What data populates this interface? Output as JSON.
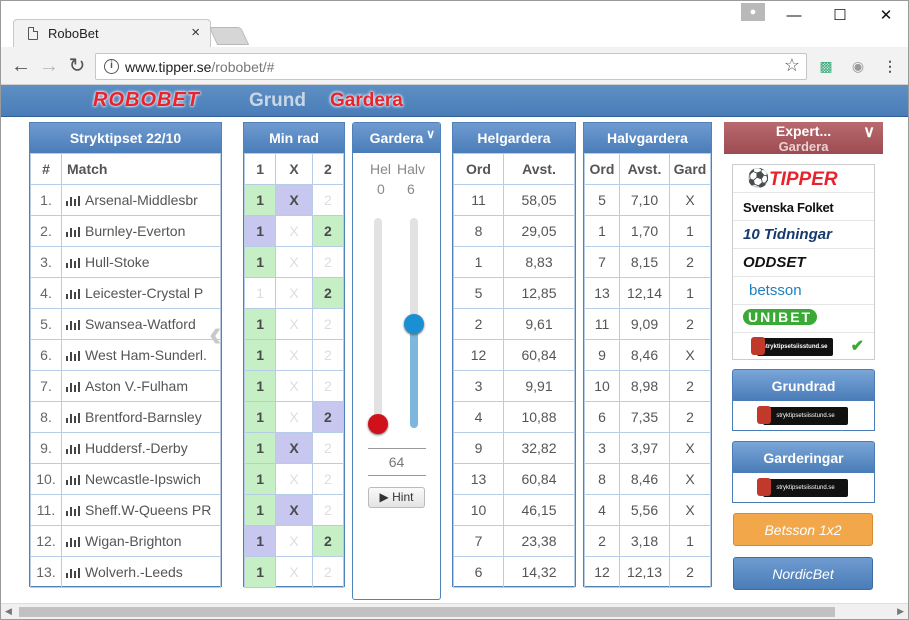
{
  "browser": {
    "tab_title": "RoboBet",
    "url_host": "www.tipper.se",
    "url_path": "/robobet/#"
  },
  "header": {
    "logo": "ROBOBET",
    "nav_grund": "Grund",
    "nav_gardera": "Gardera"
  },
  "stryktips": {
    "title": "Stryktipset 22/10",
    "col_num": "#",
    "col_match": "Match",
    "rows": [
      {
        "num": "1.",
        "match": "Arsenal-Middlesbr"
      },
      {
        "num": "2.",
        "match": "Burnley-Everton"
      },
      {
        "num": "3.",
        "match": "Hull-Stoke"
      },
      {
        "num": "4.",
        "match": "Leicester-Crystal P"
      },
      {
        "num": "5.",
        "match": "Swansea-Watford"
      },
      {
        "num": "6.",
        "match": "West Ham-Sunderl."
      },
      {
        "num": "7.",
        "match": "Aston V.-Fulham"
      },
      {
        "num": "8.",
        "match": "Brentford-Barnsley"
      },
      {
        "num": "9.",
        "match": "Huddersf.-Derby"
      },
      {
        "num": "10.",
        "match": "Newcastle-Ipswich"
      },
      {
        "num": "11.",
        "match": "Sheff.W-Queens PR"
      },
      {
        "num": "12.",
        "match": "Wigan-Brighton"
      },
      {
        "num": "13.",
        "match": "Wolverh.-Leeds"
      }
    ]
  },
  "minrad": {
    "title": "Min rad",
    "cols": [
      "1",
      "X",
      "2"
    ],
    "rows": [
      {
        "c1": "1",
        "cx": "X",
        "c2": "2",
        "s": [
          "g",
          "b",
          "d"
        ]
      },
      {
        "c1": "1",
        "cx": "X",
        "c2": "2",
        "s": [
          "b",
          "d",
          "g"
        ]
      },
      {
        "c1": "1",
        "cx": "X",
        "c2": "2",
        "s": [
          "g",
          "d",
          "d"
        ]
      },
      {
        "c1": "1",
        "cx": "X",
        "c2": "2",
        "s": [
          "d",
          "d",
          "g"
        ]
      },
      {
        "c1": "1",
        "cx": "X",
        "c2": "2",
        "s": [
          "g",
          "d",
          "d"
        ]
      },
      {
        "c1": "1",
        "cx": "X",
        "c2": "2",
        "s": [
          "g",
          "d",
          "d"
        ]
      },
      {
        "c1": "1",
        "cx": "X",
        "c2": "2",
        "s": [
          "g",
          "d",
          "d"
        ]
      },
      {
        "c1": "1",
        "cx": "X",
        "c2": "2",
        "s": [
          "g",
          "d",
          "b"
        ]
      },
      {
        "c1": "1",
        "cx": "X",
        "c2": "2",
        "s": [
          "g",
          "b",
          "d"
        ]
      },
      {
        "c1": "1",
        "cx": "X",
        "c2": "2",
        "s": [
          "g",
          "d",
          "d"
        ]
      },
      {
        "c1": "1",
        "cx": "X",
        "c2": "2",
        "s": [
          "g",
          "b",
          "d"
        ]
      },
      {
        "c1": "1",
        "cx": "X",
        "c2": "2",
        "s": [
          "b",
          "d",
          "g"
        ]
      },
      {
        "c1": "1",
        "cx": "X",
        "c2": "2",
        "s": [
          "g",
          "d",
          "d"
        ]
      }
    ]
  },
  "gardera": {
    "title": "Gardera",
    "hel_label": "Hel",
    "halv_label": "Halv",
    "hel_value": "0",
    "halv_value": "6",
    "hel_level": 0,
    "halv_level": 0.5,
    "total": "64",
    "hint_label": "Hint"
  },
  "helgardera": {
    "title": "Helgardera",
    "col_ord": "Ord",
    "col_avst": "Avst.",
    "rows": [
      [
        "11",
        "58,05"
      ],
      [
        "8",
        "29,05"
      ],
      [
        "1",
        "8,83"
      ],
      [
        "5",
        "12,85"
      ],
      [
        "2",
        "9,61"
      ],
      [
        "12",
        "60,84"
      ],
      [
        "3",
        "9,91"
      ],
      [
        "4",
        "10,88"
      ],
      [
        "9",
        "32,82"
      ],
      [
        "13",
        "60,84"
      ],
      [
        "10",
        "46,15"
      ],
      [
        "7",
        "23,38"
      ],
      [
        "6",
        "14,32"
      ]
    ]
  },
  "halvgardera": {
    "title": "Halvgardera",
    "col_ord": "Ord",
    "col_avst": "Avst.",
    "col_gard": "Gard",
    "rows": [
      [
        "5",
        "7,10",
        "X"
      ],
      [
        "1",
        "1,70",
        "1"
      ],
      [
        "7",
        "8,15",
        "2"
      ],
      [
        "13",
        "12,14",
        "1"
      ],
      [
        "11",
        "9,09",
        "2"
      ],
      [
        "9",
        "8,46",
        "X"
      ],
      [
        "10",
        "8,98",
        "2"
      ],
      [
        "6",
        "7,35",
        "2"
      ],
      [
        "3",
        "3,97",
        "X"
      ],
      [
        "8",
        "8,46",
        "X"
      ],
      [
        "4",
        "5,56",
        "X"
      ],
      [
        "2",
        "3,18",
        "1"
      ],
      [
        "12",
        "12,13",
        "2"
      ]
    ]
  },
  "expert": {
    "title": "Expert...",
    "subtitle": "Gardera"
  },
  "sources": {
    "tipper": "TIPPER",
    "svenska": "Svenska Folket",
    "tidningar": "10 Tidningar",
    "oddset": "ODDSET",
    "betsson": "betsson",
    "unibet": "UNIBET",
    "stryktipsetsiss": "stryktipsetsiisstund.se"
  },
  "buttons": {
    "grundrad": "Grundrad",
    "garderingar": "Garderingar",
    "betsson_1x2": "Betsson 1x2",
    "nordicbet": "NordicBet"
  },
  "colors": {
    "accent": "#4a7db8",
    "green": "#c6efc6",
    "blue": "#c7c7f0",
    "red": "#e8232b"
  }
}
